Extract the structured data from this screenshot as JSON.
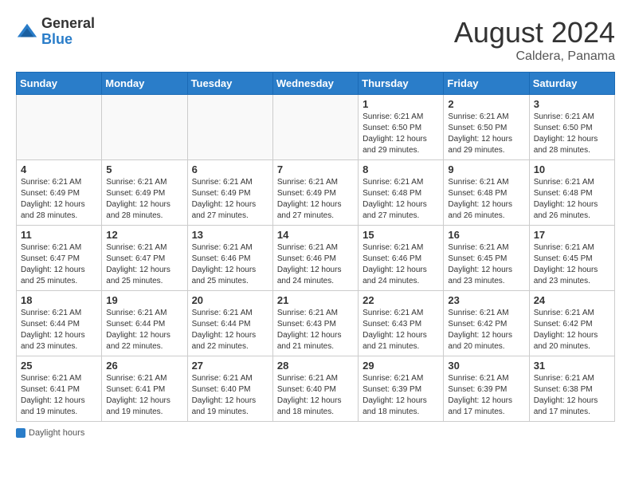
{
  "header": {
    "logo_text_general": "General",
    "logo_text_blue": "Blue",
    "main_title": "August 2024",
    "subtitle": "Caldera, Panama"
  },
  "weekdays": [
    "Sunday",
    "Monday",
    "Tuesday",
    "Wednesday",
    "Thursday",
    "Friday",
    "Saturday"
  ],
  "footer_label": "Daylight hours",
  "weeks": [
    [
      {
        "day": "",
        "sunrise": "",
        "sunset": "",
        "daylight": ""
      },
      {
        "day": "",
        "sunrise": "",
        "sunset": "",
        "daylight": ""
      },
      {
        "day": "",
        "sunrise": "",
        "sunset": "",
        "daylight": ""
      },
      {
        "day": "",
        "sunrise": "",
        "sunset": "",
        "daylight": ""
      },
      {
        "day": "1",
        "sunrise": "Sunrise: 6:21 AM",
        "sunset": "Sunset: 6:50 PM",
        "daylight": "Daylight: 12 hours and 29 minutes."
      },
      {
        "day": "2",
        "sunrise": "Sunrise: 6:21 AM",
        "sunset": "Sunset: 6:50 PM",
        "daylight": "Daylight: 12 hours and 29 minutes."
      },
      {
        "day": "3",
        "sunrise": "Sunrise: 6:21 AM",
        "sunset": "Sunset: 6:50 PM",
        "daylight": "Daylight: 12 hours and 28 minutes."
      }
    ],
    [
      {
        "day": "4",
        "sunrise": "Sunrise: 6:21 AM",
        "sunset": "Sunset: 6:49 PM",
        "daylight": "Daylight: 12 hours and 28 minutes."
      },
      {
        "day": "5",
        "sunrise": "Sunrise: 6:21 AM",
        "sunset": "Sunset: 6:49 PM",
        "daylight": "Daylight: 12 hours and 28 minutes."
      },
      {
        "day": "6",
        "sunrise": "Sunrise: 6:21 AM",
        "sunset": "Sunset: 6:49 PM",
        "daylight": "Daylight: 12 hours and 27 minutes."
      },
      {
        "day": "7",
        "sunrise": "Sunrise: 6:21 AM",
        "sunset": "Sunset: 6:49 PM",
        "daylight": "Daylight: 12 hours and 27 minutes."
      },
      {
        "day": "8",
        "sunrise": "Sunrise: 6:21 AM",
        "sunset": "Sunset: 6:48 PM",
        "daylight": "Daylight: 12 hours and 27 minutes."
      },
      {
        "day": "9",
        "sunrise": "Sunrise: 6:21 AM",
        "sunset": "Sunset: 6:48 PM",
        "daylight": "Daylight: 12 hours and 26 minutes."
      },
      {
        "day": "10",
        "sunrise": "Sunrise: 6:21 AM",
        "sunset": "Sunset: 6:48 PM",
        "daylight": "Daylight: 12 hours and 26 minutes."
      }
    ],
    [
      {
        "day": "11",
        "sunrise": "Sunrise: 6:21 AM",
        "sunset": "Sunset: 6:47 PM",
        "daylight": "Daylight: 12 hours and 25 minutes."
      },
      {
        "day": "12",
        "sunrise": "Sunrise: 6:21 AM",
        "sunset": "Sunset: 6:47 PM",
        "daylight": "Daylight: 12 hours and 25 minutes."
      },
      {
        "day": "13",
        "sunrise": "Sunrise: 6:21 AM",
        "sunset": "Sunset: 6:46 PM",
        "daylight": "Daylight: 12 hours and 25 minutes."
      },
      {
        "day": "14",
        "sunrise": "Sunrise: 6:21 AM",
        "sunset": "Sunset: 6:46 PM",
        "daylight": "Daylight: 12 hours and 24 minutes."
      },
      {
        "day": "15",
        "sunrise": "Sunrise: 6:21 AM",
        "sunset": "Sunset: 6:46 PM",
        "daylight": "Daylight: 12 hours and 24 minutes."
      },
      {
        "day": "16",
        "sunrise": "Sunrise: 6:21 AM",
        "sunset": "Sunset: 6:45 PM",
        "daylight": "Daylight: 12 hours and 23 minutes."
      },
      {
        "day": "17",
        "sunrise": "Sunrise: 6:21 AM",
        "sunset": "Sunset: 6:45 PM",
        "daylight": "Daylight: 12 hours and 23 minutes."
      }
    ],
    [
      {
        "day": "18",
        "sunrise": "Sunrise: 6:21 AM",
        "sunset": "Sunset: 6:44 PM",
        "daylight": "Daylight: 12 hours and 23 minutes."
      },
      {
        "day": "19",
        "sunrise": "Sunrise: 6:21 AM",
        "sunset": "Sunset: 6:44 PM",
        "daylight": "Daylight: 12 hours and 22 minutes."
      },
      {
        "day": "20",
        "sunrise": "Sunrise: 6:21 AM",
        "sunset": "Sunset: 6:44 PM",
        "daylight": "Daylight: 12 hours and 22 minutes."
      },
      {
        "day": "21",
        "sunrise": "Sunrise: 6:21 AM",
        "sunset": "Sunset: 6:43 PM",
        "daylight": "Daylight: 12 hours and 21 minutes."
      },
      {
        "day": "22",
        "sunrise": "Sunrise: 6:21 AM",
        "sunset": "Sunset: 6:43 PM",
        "daylight": "Daylight: 12 hours and 21 minutes."
      },
      {
        "day": "23",
        "sunrise": "Sunrise: 6:21 AM",
        "sunset": "Sunset: 6:42 PM",
        "daylight": "Daylight: 12 hours and 20 minutes."
      },
      {
        "day": "24",
        "sunrise": "Sunrise: 6:21 AM",
        "sunset": "Sunset: 6:42 PM",
        "daylight": "Daylight: 12 hours and 20 minutes."
      }
    ],
    [
      {
        "day": "25",
        "sunrise": "Sunrise: 6:21 AM",
        "sunset": "Sunset: 6:41 PM",
        "daylight": "Daylight: 12 hours and 19 minutes."
      },
      {
        "day": "26",
        "sunrise": "Sunrise: 6:21 AM",
        "sunset": "Sunset: 6:41 PM",
        "daylight": "Daylight: 12 hours and 19 minutes."
      },
      {
        "day": "27",
        "sunrise": "Sunrise: 6:21 AM",
        "sunset": "Sunset: 6:40 PM",
        "daylight": "Daylight: 12 hours and 19 minutes."
      },
      {
        "day": "28",
        "sunrise": "Sunrise: 6:21 AM",
        "sunset": "Sunset: 6:40 PM",
        "daylight": "Daylight: 12 hours and 18 minutes."
      },
      {
        "day": "29",
        "sunrise": "Sunrise: 6:21 AM",
        "sunset": "Sunset: 6:39 PM",
        "daylight": "Daylight: 12 hours and 18 minutes."
      },
      {
        "day": "30",
        "sunrise": "Sunrise: 6:21 AM",
        "sunset": "Sunset: 6:39 PM",
        "daylight": "Daylight: 12 hours and 17 minutes."
      },
      {
        "day": "31",
        "sunrise": "Sunrise: 6:21 AM",
        "sunset": "Sunset: 6:38 PM",
        "daylight": "Daylight: 12 hours and 17 minutes."
      }
    ]
  ]
}
